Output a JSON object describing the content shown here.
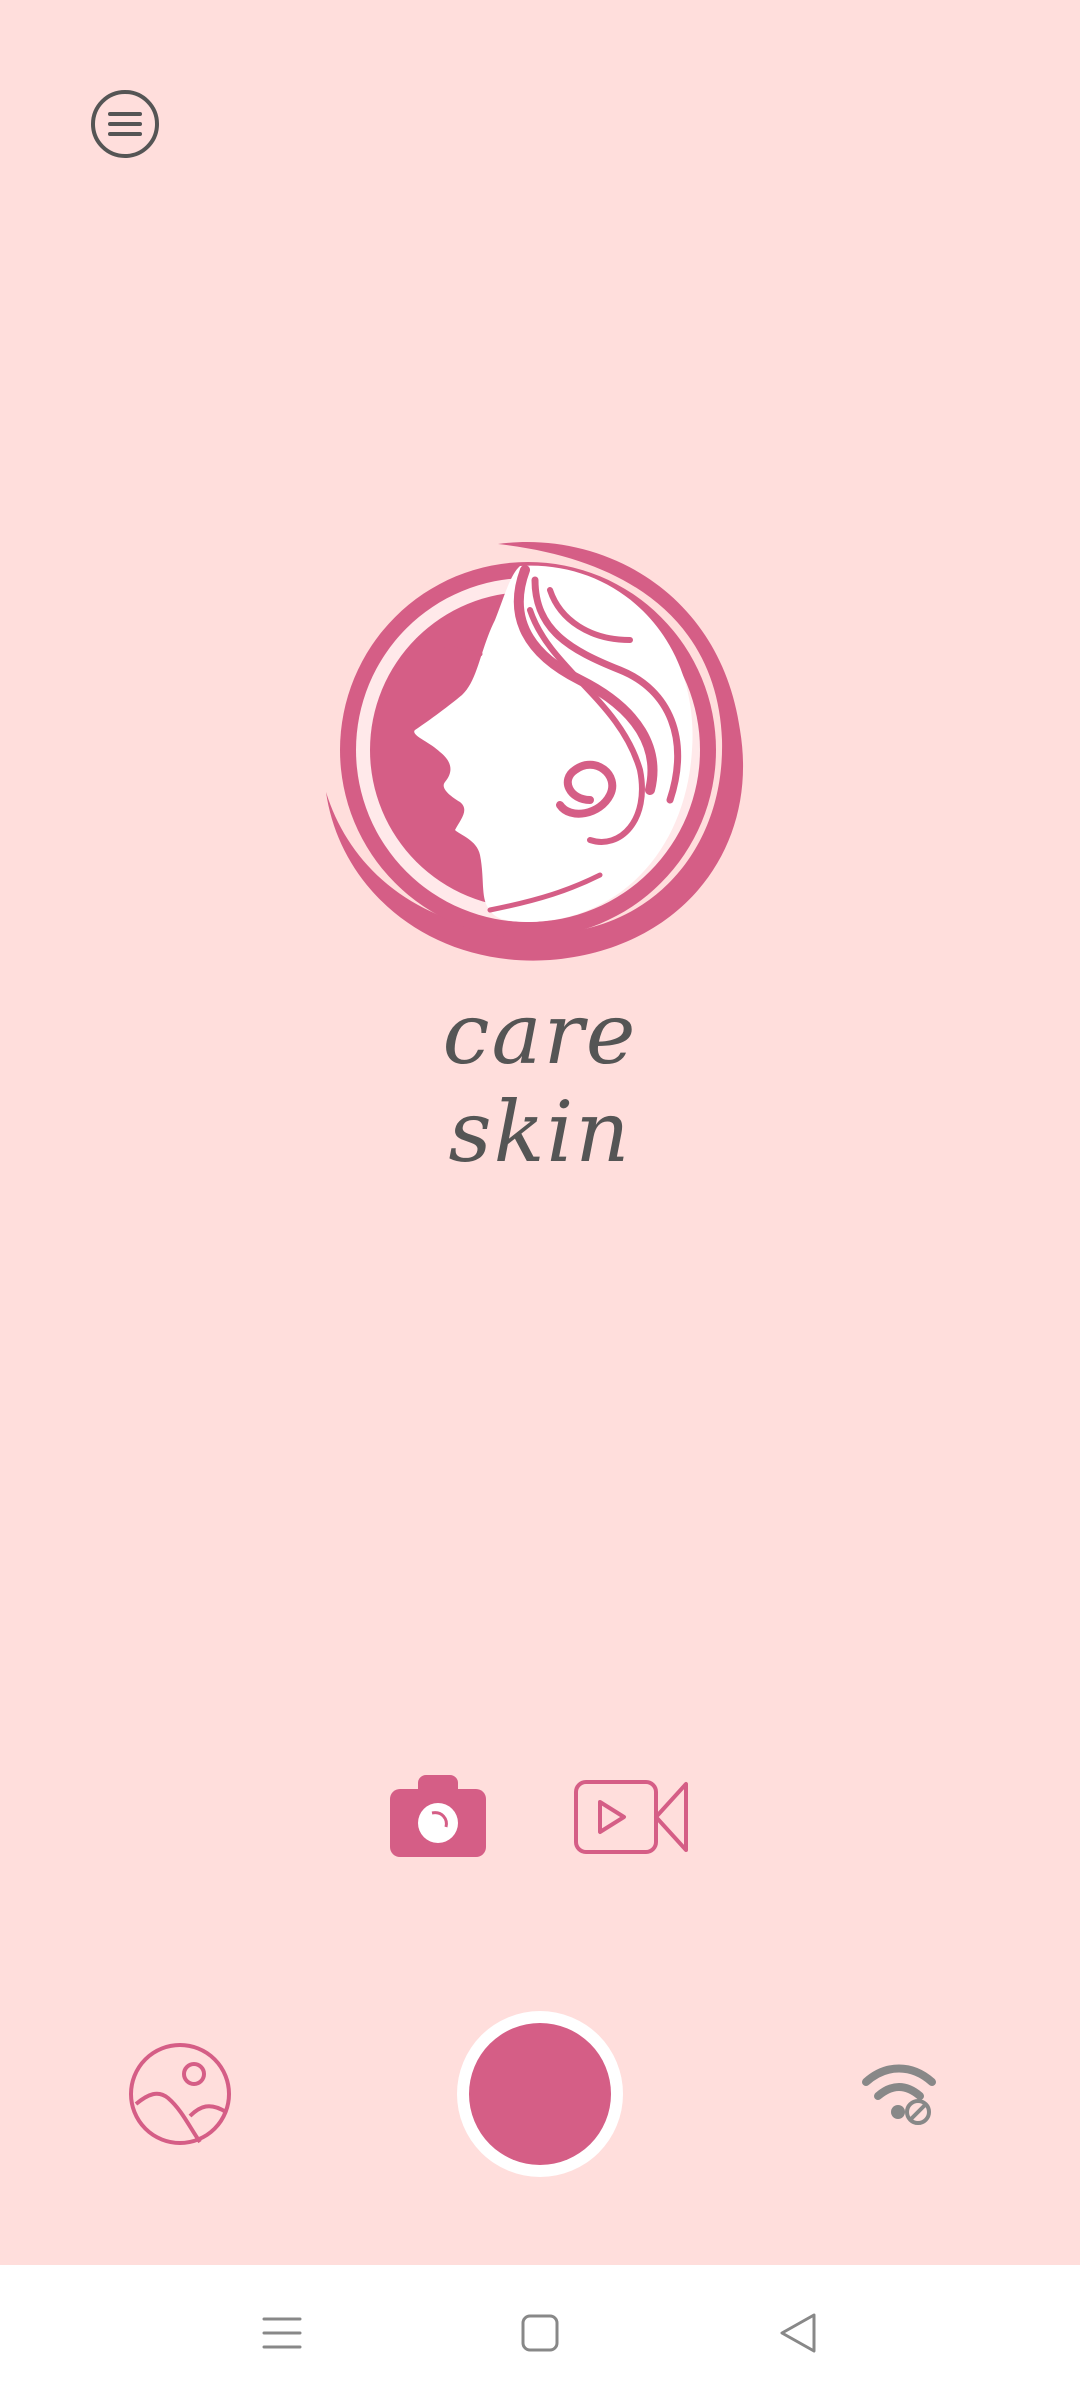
{
  "app": {
    "logo_text": "care skin"
  },
  "colors": {
    "background": "#ffdedc",
    "accent": "#d55e86",
    "icon_dark": "#555555",
    "icon_gray": "#888888",
    "navbar_bg": "#ffffff"
  },
  "icons": {
    "menu": "hamburger-menu-icon",
    "logo": "woman-face-profile-logo",
    "photo_mode": "camera-icon",
    "video_mode": "video-camera-icon",
    "gallery": "gallery-image-icon",
    "shutter": "shutter-button",
    "wifi": "wifi-disconnected-icon",
    "nav_recents": "recents-icon",
    "nav_home": "home-icon",
    "nav_back": "back-icon"
  },
  "camera": {
    "selected_mode": "photo"
  }
}
